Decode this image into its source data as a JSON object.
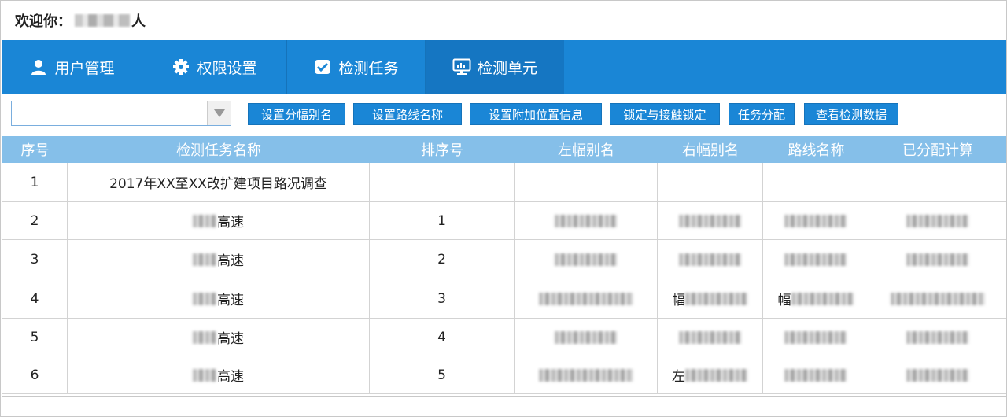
{
  "header": {
    "welcome_label": "欢迎你：",
    "user_suffix": "人"
  },
  "nav": {
    "tabs": [
      {
        "label": "用户管理",
        "icon": "user-icon"
      },
      {
        "label": "权限设置",
        "icon": "gear-icon"
      },
      {
        "label": "检测任务",
        "icon": "checkbox-icon"
      },
      {
        "label": "检测单元",
        "icon": "monitor-icon",
        "active": true
      }
    ]
  },
  "toolbar": {
    "select_value": "",
    "buttons": [
      {
        "label": "设置分幅别名"
      },
      {
        "label": "设置路线名称"
      },
      {
        "label": "设置附加位置信息"
      },
      {
        "label": "锁定与接触锁定"
      },
      {
        "label": "任务分配"
      },
      {
        "label": "查看检测数据"
      }
    ]
  },
  "table": {
    "columns": [
      "序号",
      "检测任务名称",
      "排序号",
      "左幅别名",
      "右幅别名",
      "路线名称",
      "已分配计算"
    ],
    "rows": [
      {
        "no": "1",
        "name": "2017年XX至XX改扩建项目路况调查",
        "sort": ""
      },
      {
        "no": "2",
        "name": "高速",
        "sort": "1"
      },
      {
        "no": "3",
        "name": "高速",
        "sort": "2"
      },
      {
        "no": "4",
        "name": "高速",
        "sort": "3",
        "right_prefix": "幅",
        "route_prefix": "幅"
      },
      {
        "no": "5",
        "name": "高速",
        "sort": "4"
      },
      {
        "no": "6",
        "name": "高速",
        "sort": "5",
        "right_prefix": "左"
      }
    ]
  },
  "colors": {
    "primary": "#1a86d6",
    "active_tab": "#1576c2",
    "header_row": "#85bfe9"
  }
}
